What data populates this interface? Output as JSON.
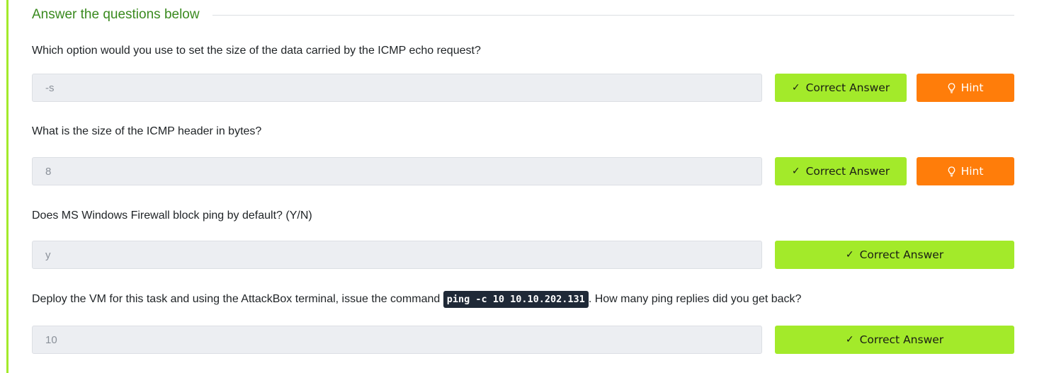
{
  "section": {
    "title": "Answer the questions below"
  },
  "questions": [
    {
      "text": "Which option would you use to set the size of the data carried by the ICMP echo request?",
      "answer": "-s",
      "correct_label": "Correct Answer",
      "hint_label": "Hint"
    },
    {
      "text": "What is the size of the ICMP header in bytes?",
      "answer": "8",
      "correct_label": "Correct Answer",
      "hint_label": "Hint"
    },
    {
      "text": "Does MS Windows Firewall block ping by default? (Y/N)",
      "answer": "y",
      "correct_label": "Correct Answer"
    },
    {
      "text_before": "Deploy the VM for this task and using the AttackBox terminal, issue the command ",
      "code": "ping -c 10 10.10.202.131",
      "text_after": ". How many ping replies did you get back?",
      "answer": "10",
      "correct_label": "Correct Answer"
    }
  ],
  "icons": {
    "correct": "check-icon",
    "hint": "lightbulb-icon"
  },
  "colors": {
    "accent_bar": "#a3ea2a",
    "title_green": "#3a8a1f",
    "correct_button": "#a3ea2a",
    "hint_button": "#ff7d0a",
    "code_bg": "#1f2937"
  }
}
